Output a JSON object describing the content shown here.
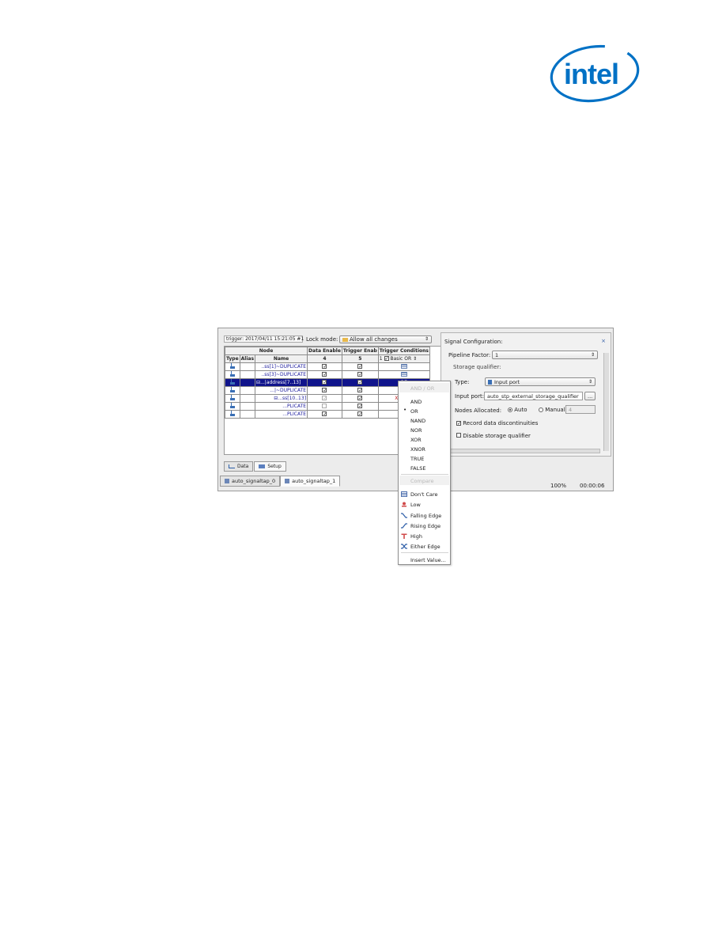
{
  "logo": {
    "text": "intel",
    "color": "#0071c5"
  },
  "toolbar": {
    "trigger_label": "trigger: 2017/04/11 15:21:05  #1",
    "lock_mode_label": "Lock mode:",
    "lock_mode_value": "Allow all changes"
  },
  "node_table": {
    "header_node": "Node",
    "header_data_enable": "Data Enable",
    "header_trigger_enable": "Trigger Enab",
    "header_trigger_conditions": "Trigger Conditions",
    "col_type": "Type",
    "col_alias": "Alias",
    "col_name": "Name",
    "data_enable_count": "4",
    "trigger_enable_count": "5",
    "trigger_cond_num": "1",
    "trigger_cond_mode": "Basic OR",
    "rows": [
      {
        "name": "..ss[1]~DUPLICATE",
        "data_enable": true,
        "trigger_enable": true,
        "condition": ""
      },
      {
        "name": "..ss[3]~DUPLICATE",
        "data_enable": true,
        "trigger_enable": true,
        "condition": ""
      },
      {
        "name": "⊟...|address[7..13]",
        "data_enable": true,
        "trigger_enable": true,
        "condition": "OR"
      },
      {
        "name": "...|~DUPLICATE",
        "data_enable": true,
        "trigger_enable": true,
        "condition": ""
      },
      {
        "name": "⊟...ss[10..13]",
        "data_enable": true,
        "trigger_enable": true,
        "condition": "Xh (OR)"
      },
      {
        "name": "...PLICATE",
        "data_enable": false,
        "trigger_enable": true,
        "condition": ""
      },
      {
        "name": "...PLICATE",
        "data_enable": true,
        "trigger_enable": true,
        "condition": ""
      }
    ]
  },
  "view_tabs": {
    "data": "Data",
    "setup": "Setup"
  },
  "file_tabs": [
    "auto_signaltap_0",
    "auto_signaltap_1"
  ],
  "status": {
    "progress": "100%",
    "time": "00:00:06"
  },
  "signal_config": {
    "title": "Signal Configuration:",
    "close": "×",
    "pipeline_factor_label": "Pipeline Factor:",
    "pipeline_factor_value": "1",
    "storage_qualifier_label": "Storage qualifier:",
    "type_label": "Type:",
    "type_value": "Input port",
    "input_port_label": "Input port:",
    "input_port_value": "auto_stp_external_storage_qualifier",
    "browse": "...",
    "nodes_allocated_label": "Nodes Allocated:",
    "auto_label": "Auto",
    "manual_label": "Manual:",
    "manual_value": "4",
    "record_label": "Record data discontinuities",
    "disable_label": "Disable storage qualifier"
  },
  "context_menu": {
    "and_or_header": "AND / OR",
    "logic_items": [
      "AND",
      "OR",
      "NAND",
      "NOR",
      "XOR",
      "XNOR",
      "TRUE",
      "FALSE"
    ],
    "selected_logic": "OR",
    "compare_header": "Compare",
    "conditions": [
      {
        "label": "Don't Care",
        "icon": "dont-care-icon"
      },
      {
        "label": "Low",
        "icon": "low-icon"
      },
      {
        "label": "Falling Edge",
        "icon": "falling-edge-icon"
      },
      {
        "label": "Rising Edge",
        "icon": "rising-edge-icon"
      },
      {
        "label": "High",
        "icon": "high-icon"
      },
      {
        "label": "Either Edge",
        "icon": "either-edge-icon"
      }
    ],
    "insert_value": "Insert Value..."
  }
}
